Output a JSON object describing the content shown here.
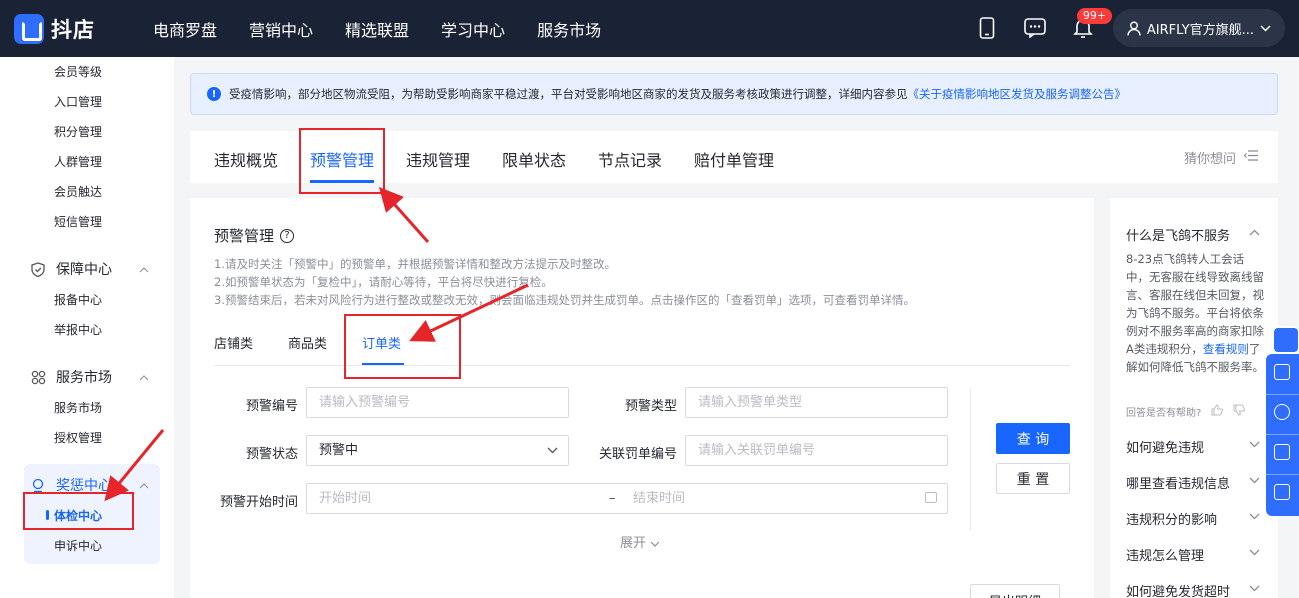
{
  "topbar": {
    "logo_text": "抖店",
    "nav": [
      "电商罗盘",
      "营销中心",
      "精选联盟",
      "学习中心",
      "服务市场"
    ],
    "badge": "99+",
    "user_name": "AIRFLY官方旗舰...",
    "bg_color": "#1a2235"
  },
  "sidebar": {
    "items_top": [
      "会员等级",
      "入口管理",
      "积分管理",
      "人群管理",
      "会员触达",
      "短信管理"
    ],
    "groups": [
      {
        "label": "保障中心",
        "icon": "shield-icon",
        "items": [
          "报备中心",
          "举报中心"
        ]
      },
      {
        "label": "服务市场",
        "icon": "grid-icon",
        "items": [
          "服务市场",
          "授权管理"
        ]
      },
      {
        "label": "奖惩中心",
        "icon": "medal-icon",
        "items": [
          "体检中心",
          "申诉中心"
        ]
      }
    ]
  },
  "notice": {
    "text": "受疫情影响，部分地区物流受阻，为帮助受影响商家平稳过渡，平台对受影响地区商家的发货及服务考核政策进行调整，详细内容参见",
    "link": "《关于疫情影响地区发货及服务调整公告》"
  },
  "tabs": {
    "items": [
      "违规概览",
      "预警管理",
      "违规管理",
      "限单状态",
      "节点记录",
      "赔付单管理"
    ],
    "active": "预警管理",
    "guess": "猜你想问"
  },
  "main": {
    "title": "预警管理",
    "tips": [
      "1.请及时关注「预警中」的预警单，并根据预警详情和整改方法提示及时整改。",
      "2.如预警单状态为「复检中」，请耐心等待，平台将尽快进行复检。",
      "3.预警结束后，若未对风险行为进行整改或整改无效，则会面临违规处罚并生成罚单。点击操作区的「查看罚单」选项，可查看罚单详情。"
    ],
    "subtabs": [
      "店铺类",
      "商品类",
      "订单类"
    ],
    "active_subtab": "订单类",
    "form": {
      "warning_id_label": "预警编号",
      "warning_id_placeholder": "请输入预警编号",
      "warning_type_label": "预警类型",
      "warning_type_placeholder": "请输入预警单类型",
      "warning_status_label": "预警状态",
      "warning_status_value": "预警中",
      "penalty_id_label": "关联罚单编号",
      "penalty_id_placeholder": "请输入关联罚单编号",
      "start_time_label": "预警开始时间",
      "start_placeholder": "开始时间",
      "range_sep": "–",
      "end_placeholder": "结束时间"
    },
    "query_label": "查 询",
    "reset_label": "重 置",
    "expand_label": "展开",
    "export_label": "导出明细"
  },
  "faq": {
    "q1": "什么是飞鸽不服务",
    "a1_part1": "8-23点飞鸽转人工会话中，无客服在线导致离线留言、客服在线但未回复，视为飞鸽不服务。平台将依条例对不服务率高的商家扣除A类违规积分，",
    "a1_link": "查看规则",
    "a1_part2": "了解如何降低飞鸽不服务率。",
    "helpful": "回答是否有帮助?",
    "questions": [
      "如何避免违规",
      "哪里查看违规信息",
      "违规积分的影响",
      "违规怎么管理",
      "如何避免发货超时"
    ]
  },
  "colors": {
    "accent": "#1966ff",
    "annotation": "#e5252a"
  }
}
